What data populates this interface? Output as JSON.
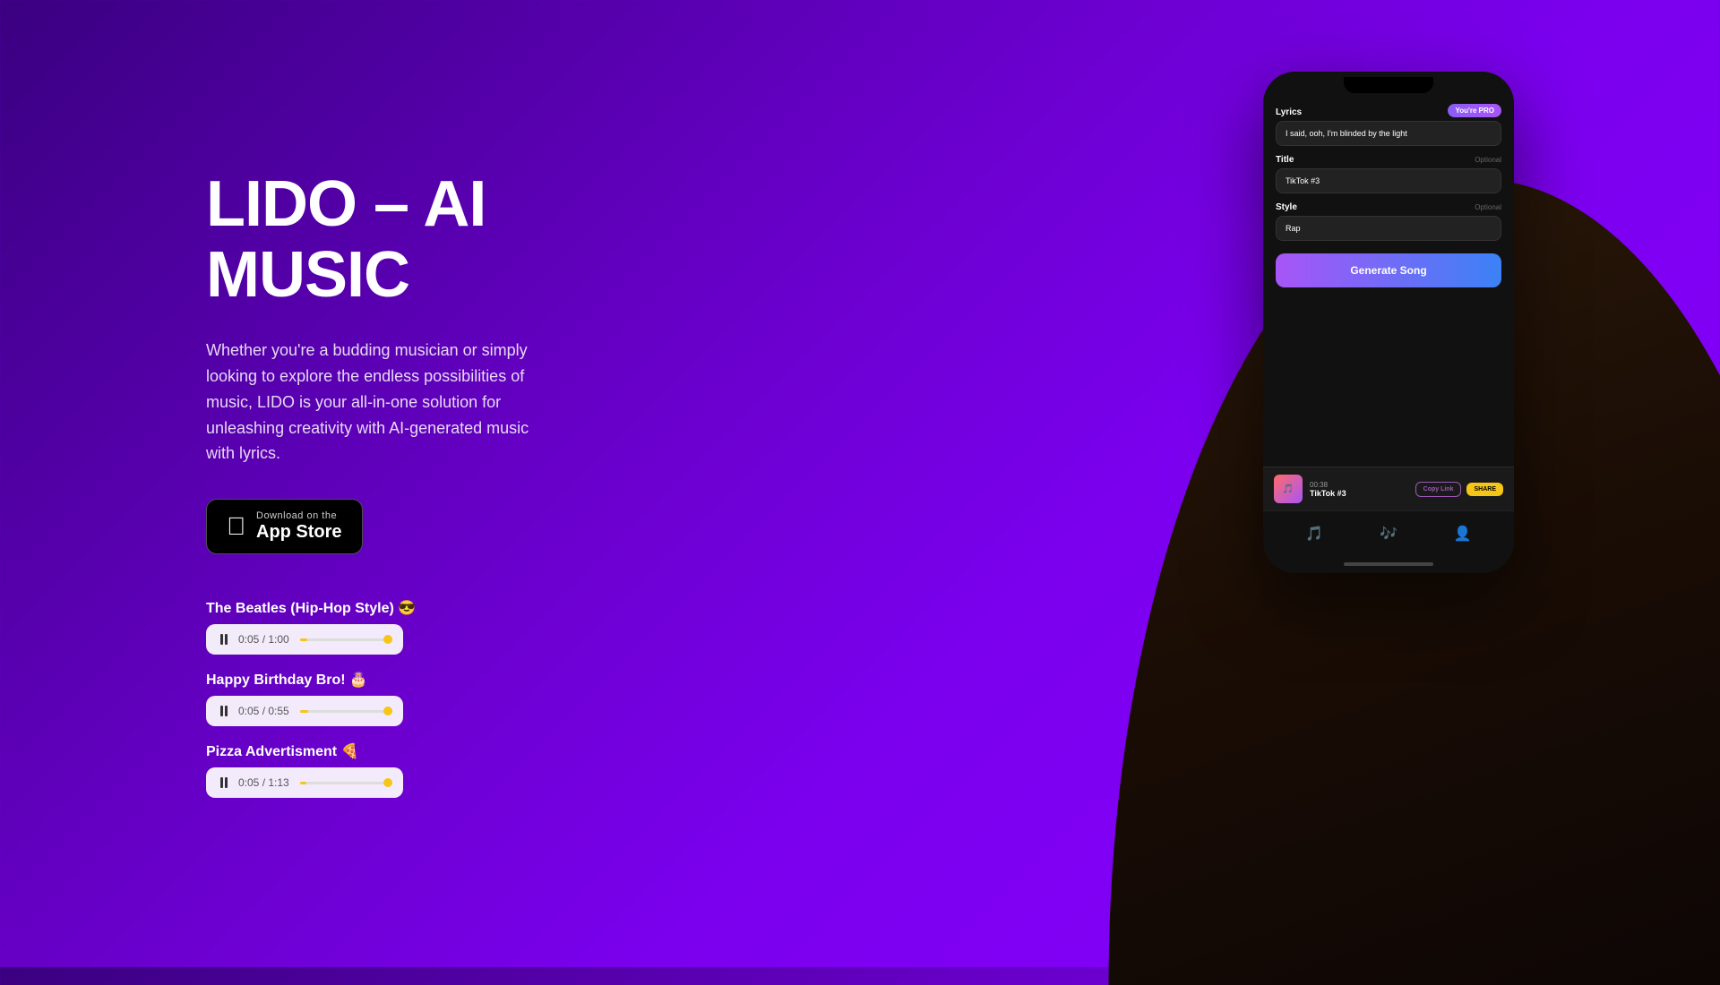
{
  "title": {
    "line1": "LIDO – AI",
    "line2": "MUSIC"
  },
  "description": "Whether you're a budding musician or simply looking to explore the endless possibilities of music, LIDO is your all-in-one solution for unleashing creativity with AI-generated music with lyrics.",
  "appStore": {
    "downloadLabel": "Download on the",
    "storeName": "App Store"
  },
  "songs": [
    {
      "title": "The Beatles (Hip-Hop Style) 😎",
      "time": "0:05 / 1:00",
      "progress": 8
    },
    {
      "title": "Happy Birthday Bro! 🎂",
      "time": "0:05 / 0:55",
      "progress": 9
    },
    {
      "title": "Pizza Advertisment 🍕",
      "time": "0:05 / 1:13",
      "progress": 7
    }
  ],
  "phone": {
    "proBadge": "You're PRO",
    "lyricsLabel": "Lyrics",
    "lyricsValue": "I said, ooh, I'm blinded by the light",
    "titleLabel": "Title",
    "titleOptional": "Optional",
    "titleValue": "TikTok #3",
    "styleLabel": "Style",
    "styleOptional": "Optional",
    "styleValue": "Rap",
    "generateBtn": "Generate Song",
    "nowPlaying": {
      "time": "00:38",
      "title": "TikTok #3",
      "copyLink": "Copy Link",
      "share": "SHARE"
    }
  }
}
